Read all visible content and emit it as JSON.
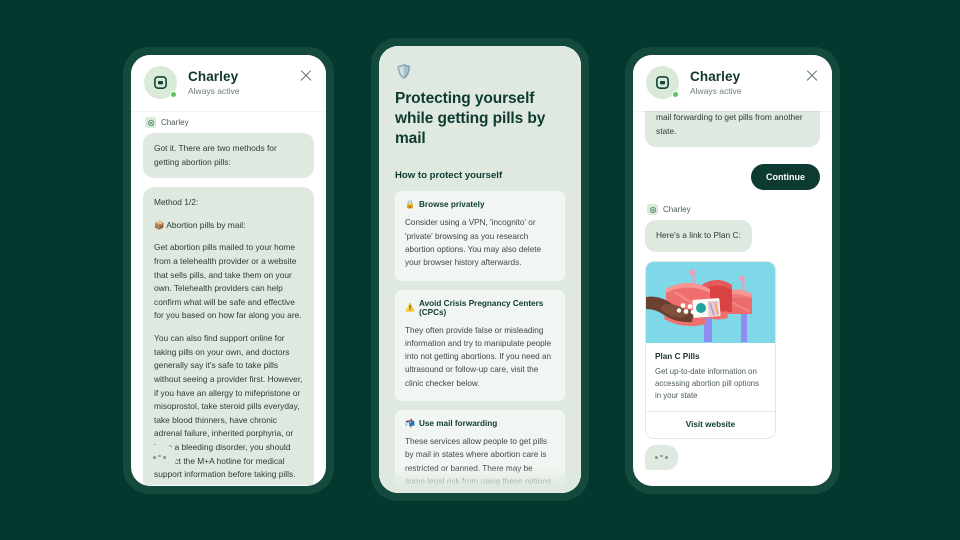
{
  "theme": {
    "background": "#04382f",
    "phone_frame": "#14493e",
    "brand_dark_green": "#0d3b31",
    "bubble_green": "#dfe9e0",
    "info_panel_bg": "#dfe9e0",
    "info_card_bg": "#f2f6f2",
    "online_dot": "#5ec75e",
    "illustration_sky": "#7fd8e8",
    "illustration_mailbox": "#ef6f6f"
  },
  "panel1": {
    "header": {
      "title": "Charley",
      "status": "Always active",
      "avatar_icon": "chat-bot-icon",
      "close_icon": "close-icon"
    },
    "sender_label": "Charley",
    "messages": [
      {
        "id": "msg-methods",
        "paragraphs": [
          "Got it. There are two methods for getting abortion pills:"
        ]
      },
      {
        "id": "msg-method-1",
        "paragraphs": [
          "Method 1/2:",
          "📦 Abortion pills by mail:",
          "Get abortion pills mailed to your home from a telehealth provider or a website that sells pills, and take them on your own. Telehealth providers can help confirm what will be safe and effective for you based on how far along you are.",
          "You can also find support online for taking pills on your own, and doctors generally say it's safe to take pills without seeing a provider first. However, if you have an allergy to mifepristone or misoprostol, take steroid pills everyday, take blood thinners, have chronic adrenal failure, inherited porphyria, or have a bleeding disorder, you should contact the M+A hotline for medical support information before taking pills."
        ]
      }
    ],
    "typing_indicator": "typing-dots"
  },
  "panel2": {
    "shield_icon": "🛡️",
    "title": "Protecting yourself while getting pills by mail",
    "section_heading": "How to protect yourself",
    "cards": [
      {
        "emoji": "🔒",
        "icon_name": "lock-icon",
        "heading": "Browse privately",
        "text": "Consider using a VPN, 'incognito' or 'private' browsing as you research abortion options. You may also delete your browser history afterwards."
      },
      {
        "emoji": "⚠️",
        "icon_name": "warning-icon",
        "heading": "Avoid Crisis Pregnancy Centers (CPCs)",
        "text": "They often provide false or misleading information and try to manipulate people into not getting abortions. If you need an ultrasound or follow-up care, visit the clinic checker below."
      },
      {
        "emoji": "📬",
        "icon_name": "mailbox-icon",
        "heading": "Use mail forwarding",
        "text": "These services allow people to get pills by mail in states where abortion care is restricted or banned. There may be some legal risk from using these options, but"
      }
    ]
  },
  "panel3": {
    "header": {
      "title": "Charley",
      "status": "Always active",
      "avatar_icon": "chat-bot-icon",
      "close_icon": "close-icon"
    },
    "clipped_message": "mail forwarding to get pills from another state.",
    "continue_label": "Continue",
    "sender_label": "Charley",
    "link_intro": "Here's a link to Plan C:",
    "link_card": {
      "art_name": "mailboxes-with-hand-holding-pills-illustration",
      "title": "Plan C Pills",
      "description": "Get up-to-date information on accessing abortion pill options in your state",
      "action_label": "Visit website"
    },
    "typing_indicator": "typing-dots"
  }
}
